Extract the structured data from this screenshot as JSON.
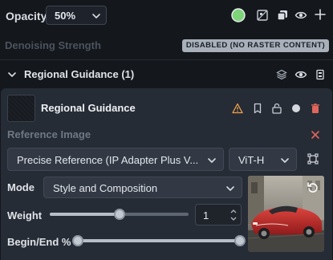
{
  "layer": {
    "opacity_label": "Opacity",
    "opacity_value": "50%",
    "swatch_color": "#7ed37a",
    "denoising_label": "Denoising Strength",
    "denoising_badge": "DISABLED (NO RASTER CONTENT)"
  },
  "regional_guidance_header": {
    "title": "Regional Guidance (1)"
  },
  "regional_guidance_card": {
    "title": "Regional Guidance",
    "reference_image_label": "Reference Image",
    "model_select_value": "Precise Reference (IP Adapter Plus V...",
    "clip_vision_value": "ViT-H",
    "mode_label": "Mode",
    "mode_value": "Style and Composition",
    "weight_label": "Weight",
    "weight_value": "1",
    "weight_slider_fraction": 0.5,
    "begin_end_label": "Begin/End %",
    "begin_end_range": [
      0,
      100
    ]
  },
  "colors": {
    "accent_green": "#7ed37a",
    "delete_red": "#e0655d",
    "warning_orange": "#f2a14b"
  },
  "icons": [
    "chevron-down-icon",
    "swatch-icon",
    "transparency-icon",
    "layers-stack-icon",
    "eye-icon",
    "plus-icon",
    "collapse-chevron-icon",
    "stack-icon",
    "sliders-icon",
    "warning-icon",
    "bookmark-icon",
    "lock-icon",
    "circle-icon",
    "trash-icon",
    "close-icon",
    "crop-icon",
    "reset-icon"
  ]
}
